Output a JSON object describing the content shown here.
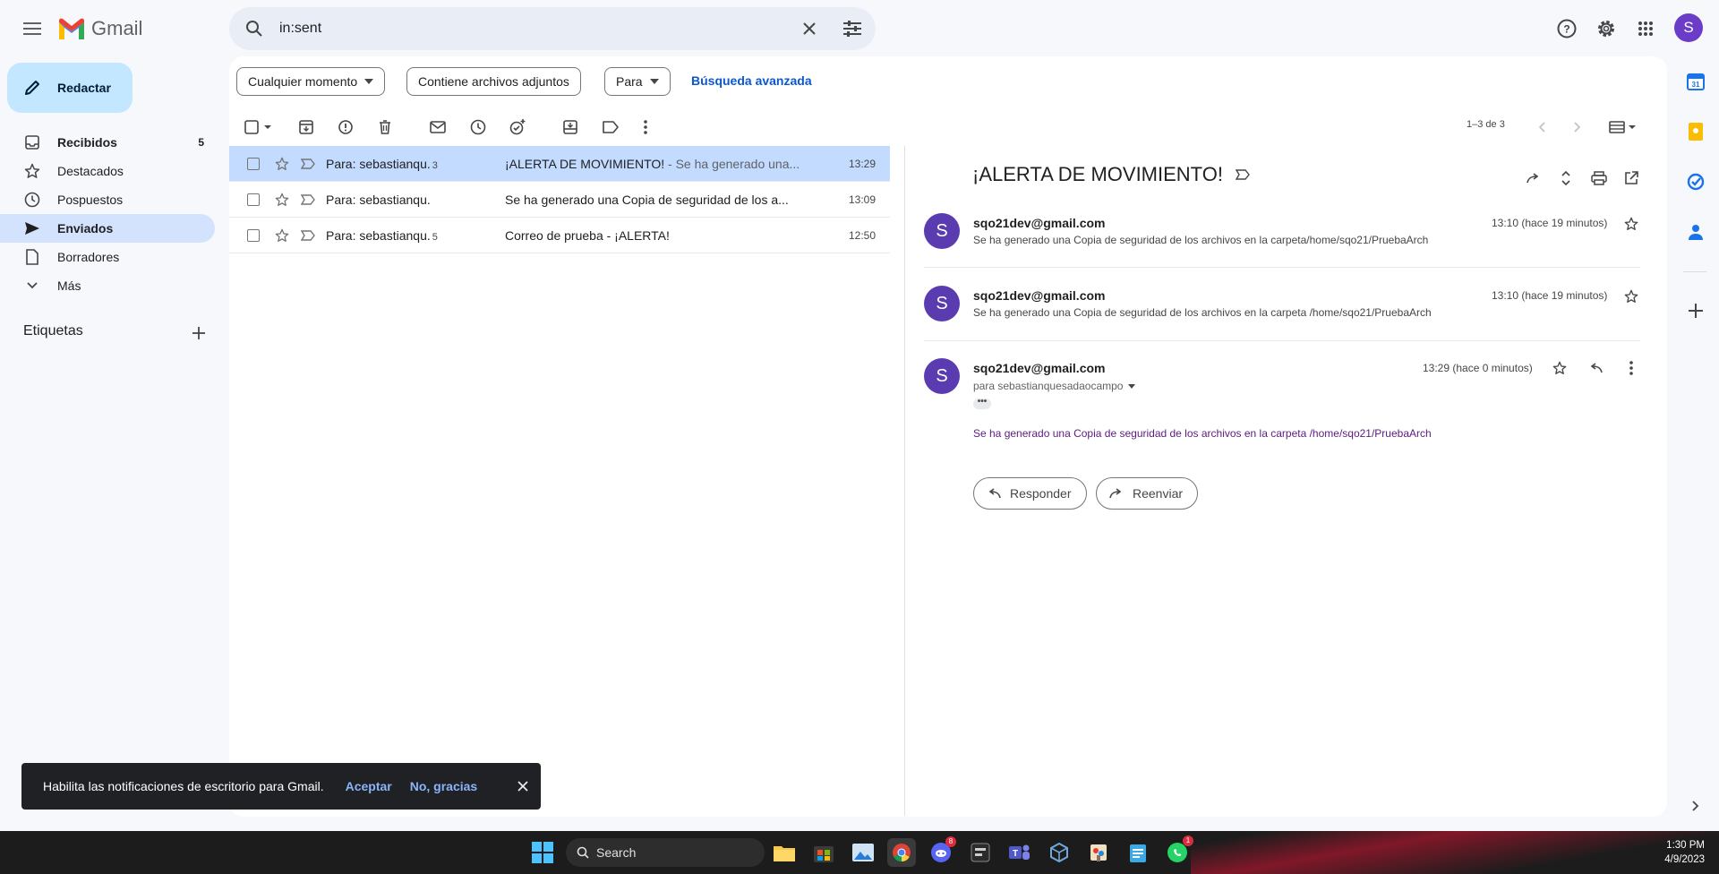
{
  "app": {
    "name": "Gmail"
  },
  "search": {
    "query": "in:sent"
  },
  "compose_label": "Redactar",
  "sidebar": {
    "items": [
      {
        "label": "Recibidos",
        "count": "5",
        "icon": "inbox-icon"
      },
      {
        "label": "Destacados",
        "count": "",
        "icon": "star-icon"
      },
      {
        "label": "Pospuestos",
        "count": "",
        "icon": "clock-icon"
      },
      {
        "label": "Enviados",
        "count": "",
        "icon": "send-icon"
      },
      {
        "label": "Borradores",
        "count": "",
        "icon": "draft-icon"
      },
      {
        "label": "Más",
        "count": "",
        "icon": "chevron-down-icon"
      }
    ],
    "labels_title": "Etiquetas"
  },
  "filters": {
    "chip1": "Cualquier momento",
    "chip2": "Contiene archivos adjuntos",
    "chip3": "Para",
    "advanced": "Búsqueda avanzada"
  },
  "pagination": "1–3 de 3",
  "emails": [
    {
      "to": "Para: sebastianqu.",
      "count": "3",
      "subject": "¡ALERTA DE MOVIMIENTO!",
      "snippet": " - Se ha generado una...",
      "time": "13:29",
      "selected": true
    },
    {
      "to": "Para: sebastianqu.",
      "count": "",
      "subject": "Se ha generado una Copia de seguridad de los a...",
      "snippet": "",
      "time": "13:09",
      "selected": false
    },
    {
      "to": "Para: sebastianqu.",
      "count": "5",
      "subject": "Correo de prueba - ¡ALERTA!",
      "snippet": "",
      "time": "12:50",
      "selected": false
    }
  ],
  "thread": {
    "title": "¡ALERTA DE MOVIMIENTO!",
    "messages": [
      {
        "avatar": "S",
        "from": "sqo21dev@gmail.com",
        "snippet": "Se ha generado una Copia de seguridad de los archivos en la carpeta/home/sqo21/PruebaArch",
        "time": "13:10 (hace 19 minutos)"
      },
      {
        "avatar": "S",
        "from": "sqo21dev@gmail.com",
        "snippet": "Se ha generado una Copia de seguridad de los archivos en la carpeta /home/sqo21/PruebaArch",
        "time": "13:10 (hace 19 minutos)"
      },
      {
        "avatar": "S",
        "from": "sqo21dev@gmail.com",
        "to": "para sebastianquesadaocampo",
        "body": "Se ha generado una Copia de seguridad de los archivos en la carpeta /home/sqo21/PruebaArch",
        "time": "13:29 (hace 0 minutos)"
      }
    ],
    "reply_label": "Responder",
    "forward_label": "Reenviar"
  },
  "snackbar": {
    "message": "Habilita las notificaciones de escritorio para Gmail.",
    "accept": "Aceptar",
    "decline": "No, gracias"
  },
  "taskbar": {
    "search_label": "Search",
    "time": "1:30 PM",
    "date": "4/9/2023",
    "discord_badge": "8",
    "whatsapp_badge": "1"
  },
  "colors": {
    "accent": "#0b57d0",
    "compose_bg": "#c2e7ff",
    "active_nav": "#d3e3fd",
    "selected_row": "#c2dbff",
    "avatar": "#5a3bb0"
  }
}
